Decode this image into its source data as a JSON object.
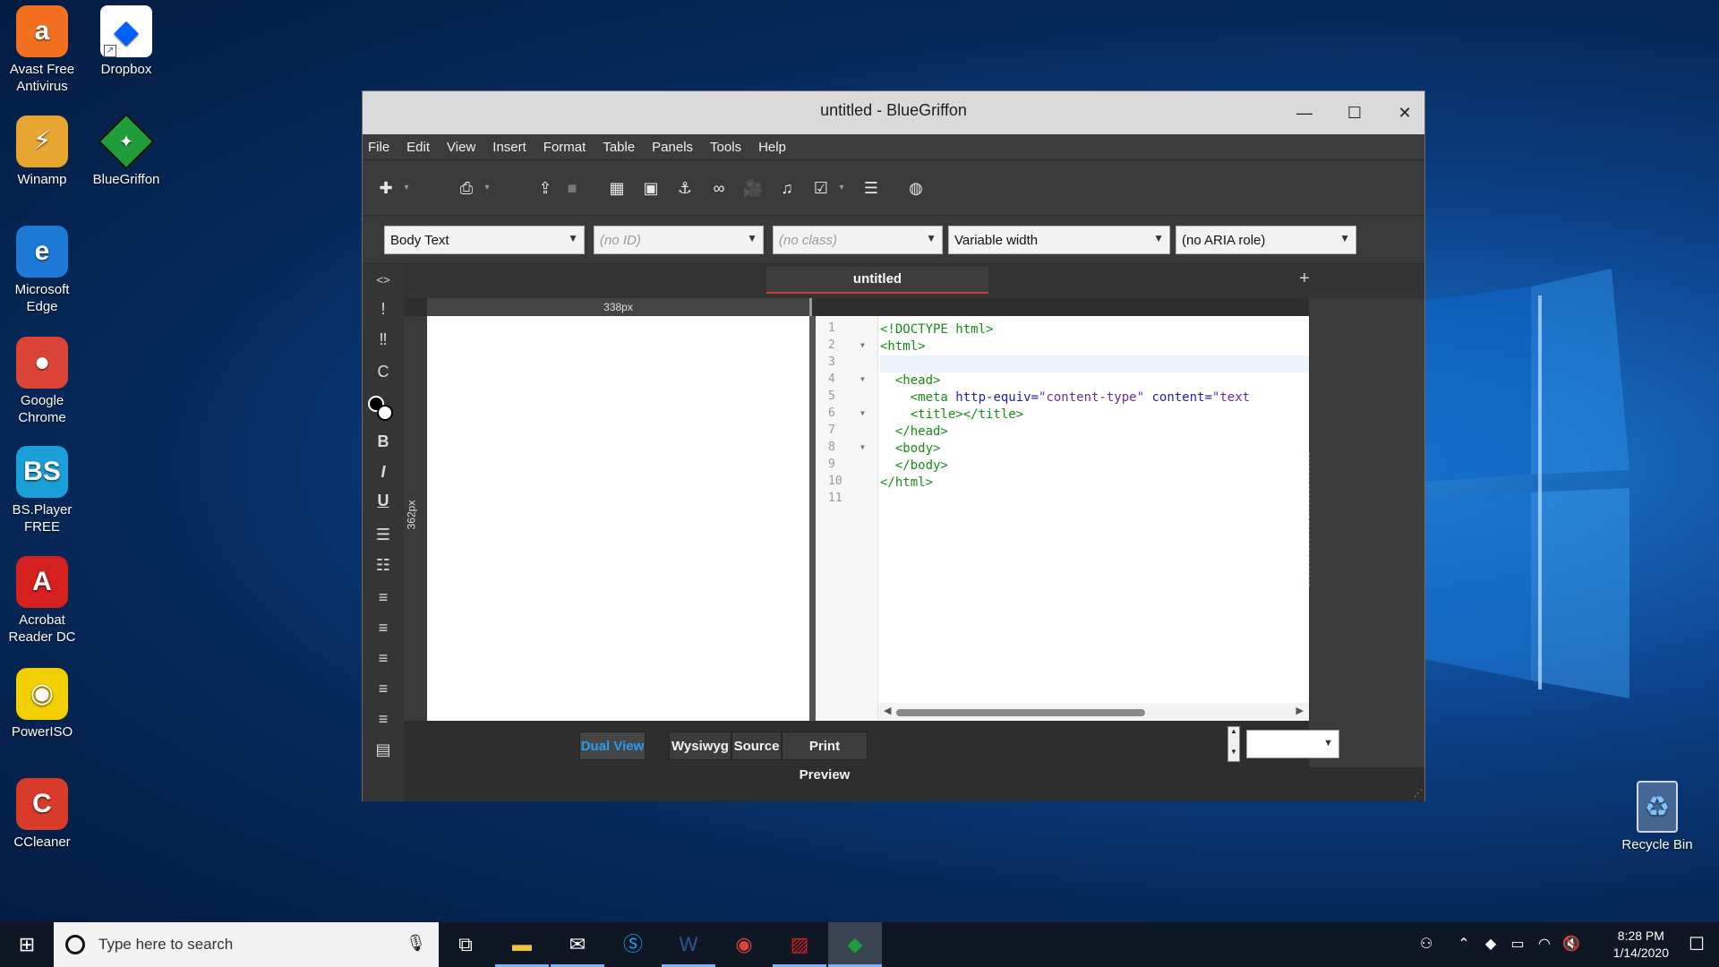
{
  "desktop": {
    "icons_left": [
      {
        "label": "Avast Free Antivirus",
        "glyph": "a",
        "color": "#f37021"
      },
      {
        "label": "Winamp",
        "glyph": "⚡",
        "color": "#e8a531"
      },
      {
        "label": "Microsoft Edge",
        "glyph": "e",
        "color": "#1e78d6"
      },
      {
        "label": "Google Chrome",
        "glyph": "●",
        "color": "#db4437"
      },
      {
        "label": "BS.Player FREE",
        "glyph": "BS",
        "color": "#1a9fd8"
      },
      {
        "label": "Acrobat Reader DC",
        "glyph": "A",
        "color": "#d4201f"
      },
      {
        "label": "PowerISO",
        "glyph": "◉",
        "color": "#f2d000"
      },
      {
        "label": "CCleaner",
        "glyph": "C",
        "color": "#d93b2b"
      }
    ],
    "icons_second": [
      {
        "label": "Dropbox",
        "glyph": "◆",
        "color": "#0061fe"
      },
      {
        "label": "BlueGriffon",
        "glyph": "◆",
        "color": "#1f9d3a"
      }
    ],
    "recycle_bin": {
      "label": "Recycle Bin",
      "glyph": "♻"
    }
  },
  "window": {
    "title": "untitled - BlueGriffon",
    "controls": {
      "minimize": "—",
      "maximize": "☐",
      "close": "✕"
    },
    "menu": [
      "File",
      "Edit",
      "View",
      "Insert",
      "Format",
      "Table",
      "Panels",
      "Tools",
      "Help"
    ],
    "toolbar_icons": [
      "new-icon",
      "save-icon",
      "export-icon",
      "stop-icon",
      "table-icon",
      "image-icon",
      "anchor-icon",
      "link-icon",
      "video-icon",
      "audio-icon",
      "form-icon",
      "list-icon",
      "globe-icon"
    ],
    "properties": {
      "paragraph_format": "Body Text",
      "id_placeholder": "(no ID)",
      "class_placeholder": "(no class)",
      "width": "Variable width",
      "aria_role": "(no ARIA role)"
    },
    "side_tools": [
      "<>",
      "!",
      "‼",
      "C",
      "B",
      "I",
      "U"
    ],
    "tab": {
      "title": "untitled",
      "add": "+"
    },
    "ruler": {
      "width_label": "338px",
      "height_label": "362px"
    },
    "source": {
      "line_numbers": [
        "1",
        "2",
        "3",
        "4",
        "5",
        "6",
        "7",
        "8",
        "9",
        "10",
        "11"
      ],
      "lines": [
        {
          "text": "<!DOCTYPE html>"
        },
        {
          "text": "<html>"
        },
        {
          "text": ""
        },
        {
          "text": "  <head>"
        },
        {
          "text": "    <meta http-equiv=\"content-type\" content=\"text"
        },
        {
          "text": "    <title></title>"
        },
        {
          "text": "  </head>"
        },
        {
          "text": "  <body>"
        },
        {
          "text": "  </body>"
        },
        {
          "text": "</html>"
        },
        {
          "text": ""
        }
      ]
    },
    "view_buttons": {
      "dual": "Dual View",
      "wysiwyg": "Wysiwyg",
      "source": "Source",
      "print_preview": "Print Preview"
    }
  },
  "taskbar": {
    "search_placeholder": "Type here to search",
    "time": "8:28 PM",
    "date": "1/14/2020",
    "apps": [
      "task-view-icon",
      "file-explorer-icon",
      "mail-icon",
      "skype-icon",
      "word-icon",
      "chrome-icon",
      "pdf-icon",
      "bluegriffon-icon"
    ]
  },
  "colors": {
    "accent": "#2a9bf0",
    "tab_underline": "#d43a3a",
    "doctype": "#d43131",
    "tag": "#1a8a1a"
  }
}
